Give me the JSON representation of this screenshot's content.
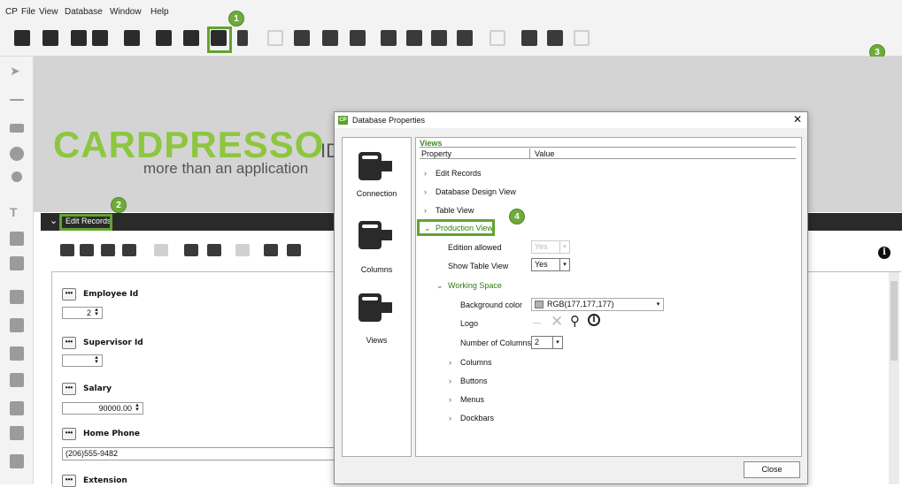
{
  "menu": {
    "items": [
      "CP",
      "File",
      "View",
      "Database",
      "Window",
      "Help"
    ]
  },
  "badges": {
    "b1": "1",
    "b2": "2",
    "b3": "3",
    "b4": "4"
  },
  "accent_color": "#62a330",
  "logo": {
    "brand": "CARDPRESSO",
    "tagline": "more than an application",
    "partial_text": "ID"
  },
  "edit_bar": {
    "label": "Edit Records"
  },
  "form": {
    "fields": [
      {
        "label": "Employee Id",
        "value": "2"
      },
      {
        "label": "Supervisor Id",
        "value": ""
      },
      {
        "label": "Salary",
        "value": "90000.00"
      },
      {
        "label": "Home Phone",
        "value": "(206)555-9482"
      },
      {
        "label": "Extension",
        "value": ""
      }
    ]
  },
  "dialog": {
    "title": "Database Properties",
    "icon_text": "CP",
    "close_glyph": "✕",
    "nav": [
      {
        "label": "Connection"
      },
      {
        "label": "Columns"
      },
      {
        "label": "Views"
      }
    ],
    "section_title": "Views",
    "columns": {
      "property": "Property",
      "value": "Value"
    },
    "tree": {
      "edit_records": "Edit Records",
      "database_design_view": "Database Design View",
      "table_view": "Table View",
      "production_view": "Production View",
      "edition_allowed": {
        "label": "Edition allowed",
        "value": "Yes"
      },
      "show_table_view": {
        "label": "Show Table View",
        "value": "Yes"
      },
      "working_space": "Working Space",
      "background_color": {
        "label": "Background color",
        "value": "RGB(177,177,177)",
        "swatch": "#b1b1b1"
      },
      "logo": {
        "label": "Logo",
        "value": "—"
      },
      "number_of_columns": {
        "label": "Number of Columns",
        "value": "2"
      },
      "columns": "Columns",
      "buttons": "Buttons",
      "menus": "Menus",
      "dockbars": "Dockbars"
    },
    "close_button": "Close"
  }
}
